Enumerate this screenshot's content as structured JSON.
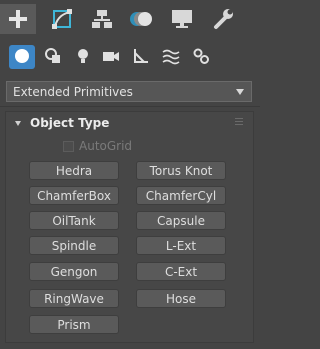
{
  "command_tabs": [
    {
      "name": "create",
      "icon": "plus-icon",
      "active": true
    },
    {
      "name": "modify",
      "icon": "modify-icon",
      "active": false
    },
    {
      "name": "hierarchy",
      "icon": "hierarchy-icon",
      "active": false
    },
    {
      "name": "motion",
      "icon": "motion-icon",
      "active": false
    },
    {
      "name": "display",
      "icon": "display-icon",
      "active": false
    },
    {
      "name": "utilities",
      "icon": "wrench-icon",
      "active": false
    }
  ],
  "categories": [
    {
      "name": "geometry",
      "icon": "sphere-icon",
      "active": true
    },
    {
      "name": "shapes",
      "icon": "shapes-icon",
      "active": false
    },
    {
      "name": "lights",
      "icon": "light-bulb-icon",
      "active": false
    },
    {
      "name": "cameras",
      "icon": "camera-icon",
      "active": false
    },
    {
      "name": "helpers",
      "icon": "helpers-icon",
      "active": false
    },
    {
      "name": "space-warps",
      "icon": "space-warp-icon",
      "active": false
    },
    {
      "name": "systems",
      "icon": "systems-icon",
      "active": false
    }
  ],
  "dropdown": {
    "value": "Extended Primitives"
  },
  "rollout": {
    "title": "Object Type",
    "autogrid_label": "AutoGrid",
    "buttons": [
      "Hedra",
      "Torus Knot",
      "ChamferBox",
      "ChamferCyl",
      "OilTank",
      "Capsule",
      "Spindle",
      "L-Ext",
      "Gengon",
      "C-Ext",
      "RingWave",
      "Hose",
      "Prism"
    ]
  },
  "colors": {
    "accent": "#3d86c6",
    "panel": "#444444",
    "button": "#5a5a5a"
  }
}
